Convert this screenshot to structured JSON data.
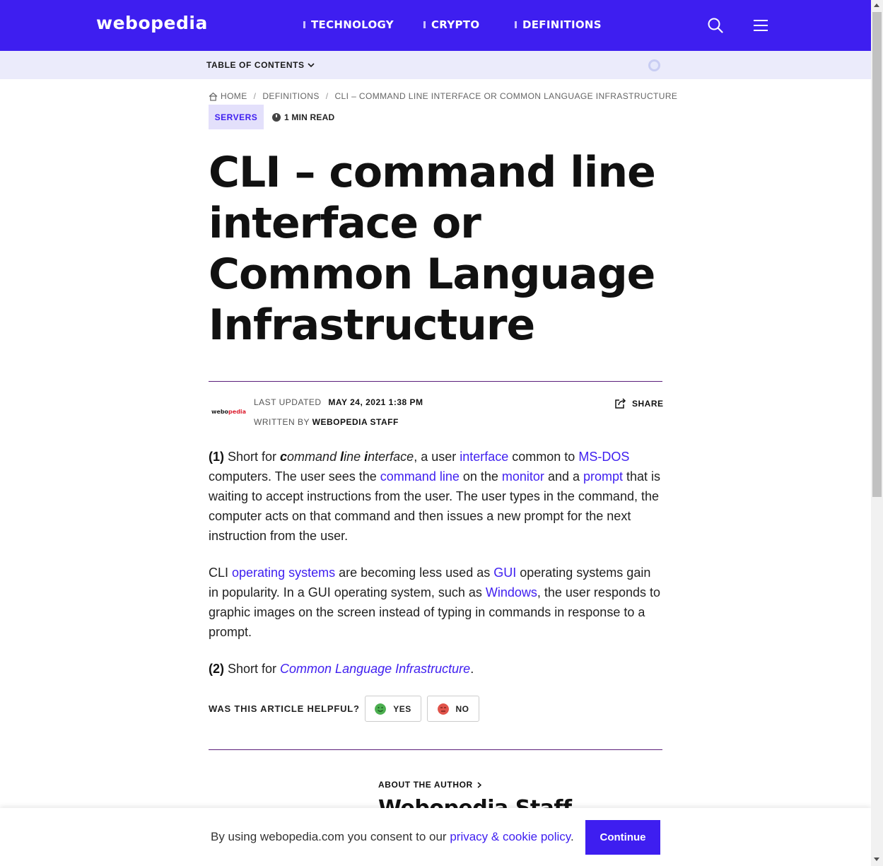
{
  "header": {
    "logo": "webopedia",
    "nav": [
      "TECHNOLOGY",
      "CRYPTO",
      "DEFINITIONS"
    ],
    "search_icon": "search-icon",
    "menu_icon": "hamburger-menu-icon"
  },
  "toc": {
    "label": "TABLE OF CONTENTS",
    "progress": 0
  },
  "breadcrumb": {
    "home": "HOME",
    "definitions": "DEFINITIONS",
    "current": "CLI – COMMAND LINE INTERFACE OR COMMON LANGUAGE INFRASTRUCTURE"
  },
  "article": {
    "tag": "SERVERS",
    "read_time": "1 MIN READ",
    "title": "CLI – command line interface or Common Language Infrastructure",
    "author_logo_a": "webo",
    "author_logo_b": "pedia",
    "last_updated_label": "LAST UPDATED",
    "last_updated_value": "MAY 24, 2021 1:38 PM",
    "written_by_label": "WRITTEN BY",
    "written_by_value": "WEBOPEDIA STAFF",
    "share": "SHARE"
  },
  "p1": {
    "num": "(1)",
    "t1": " Short for ",
    "c": "c",
    "ommand": "ommand ",
    "l": "l",
    "ine": "ine ",
    "i": "i",
    "nterface": "nterface",
    "t2": ", a user ",
    "link_interface": "interface",
    "t3": " common to ",
    "link_msdos": "MS-DOS",
    "t4": " computers. The user sees the ",
    "link_cmdline": "command line",
    "t5": " on the ",
    "link_monitor": "monitor",
    "t6": " and a ",
    "link_prompt": "prompt",
    "t7": " that is waiting to accept instructions from the user. The user types in the command, the computer acts on that command and then issues a new prompt for the next instruction from the user."
  },
  "p2": {
    "t1": "CLI ",
    "link_os": "operating systems",
    "t2": " are becoming less used as ",
    "link_gui": "GUI",
    "t3": " operating systems gain in popularity. In a GUI operating system, such as ",
    "link_windows": "Windows",
    "t4": ", the user responds to graphic images on the screen instead of typing in commands in response to a prompt."
  },
  "p3": {
    "num": "(2)",
    "t1": " Short for ",
    "link_cli": "Common Language Infrastructure",
    "t2": "."
  },
  "feedback": {
    "label": "WAS THIS ARTICLE HELPFUL?",
    "yes": "YES",
    "no": "NO"
  },
  "author_box": {
    "about": "ABOUT THE AUTHOR",
    "name": "Webopedia Staff"
  },
  "cookie": {
    "text": "By using webopedia.com you consent to our ",
    "link": "privacy & cookie policy",
    "after": ".",
    "button": "Continue"
  },
  "colors": {
    "brand": "#3e1ef0",
    "toc_bg": "#ebebfb",
    "rule": "#5b1e7a"
  }
}
